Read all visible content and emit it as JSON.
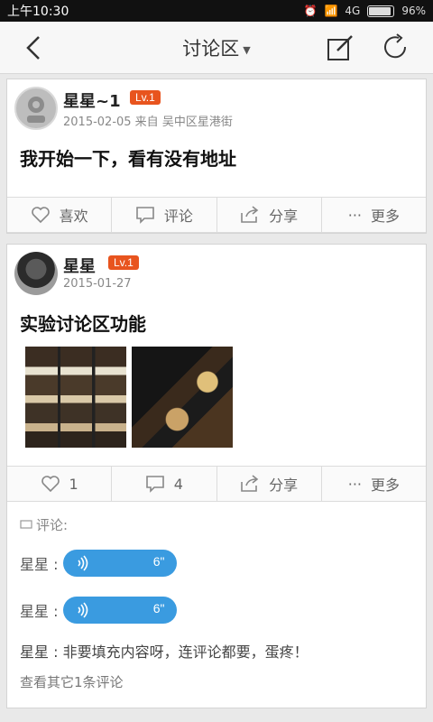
{
  "status_bar": {
    "time": "上午10:30",
    "signal_text": "4G",
    "battery": "96%",
    "battery_level": 0.96
  },
  "nav": {
    "title": "讨论区",
    "icons": [
      "back-arrow-icon",
      "caret-down-icon",
      "edit-icon",
      "refresh-icon"
    ]
  },
  "posts": [
    {
      "username": "星星~1",
      "level": "Lv.1",
      "meta": "2015-02-05  来自  吴中区星港街",
      "content": "我开始一下，看有没有地址",
      "actions": {
        "like": "喜欢",
        "comment": "评论",
        "share": "分享",
        "more": "更多"
      }
    },
    {
      "username": "星星",
      "level": "Lv.1",
      "meta": "2015-01-27",
      "content": "实验讨论区功能",
      "actions": {
        "like": "1",
        "comment": "4",
        "share": "分享",
        "more": "更多"
      },
      "comments": {
        "header": "评论:",
        "voice": [
          {
            "author": "星星 :",
            "duration": "6\""
          },
          {
            "author": "星星 :",
            "duration": "6\""
          }
        ],
        "text": "星星 : 非要填充内容呀，连评论都要，蛋疼！",
        "more": "查看其它1条评论"
      }
    }
  ],
  "colors": {
    "accent": "#e8541e",
    "voice": "#3a9be0",
    "background": "#e9e9e9"
  }
}
